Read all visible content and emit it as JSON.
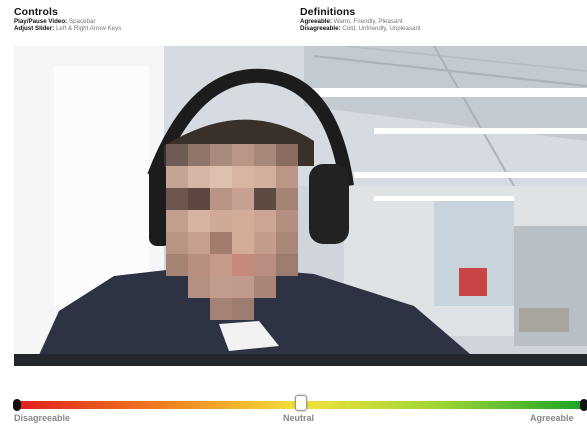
{
  "controls": {
    "title": "Controls",
    "play_pause_key": "Play/Pause Video:",
    "play_pause_value": "Spacebar",
    "adjust_key": "Adjust Slider:",
    "adjust_value": "Left & Right Arrow Keys"
  },
  "definitions": {
    "title": "Definitions",
    "agreeable_key": "Agreeable:",
    "agreeable_value": "Warm, Friendly, Pleasant",
    "disagreeable_key": "Disagreeable:",
    "disagreeable_value": "Cold, Unfriendly, Unpleasant"
  },
  "video": {
    "playing": false,
    "subject": "pixelated face of person wearing headphones in office"
  },
  "slider": {
    "min_label": "Disagreeable",
    "mid_label": "Neutral",
    "max_label": "Agreeable",
    "value": 0.5,
    "colors": {
      "low": "#e01c1c",
      "mid": "#f4e23a",
      "high": "#18a324"
    }
  }
}
